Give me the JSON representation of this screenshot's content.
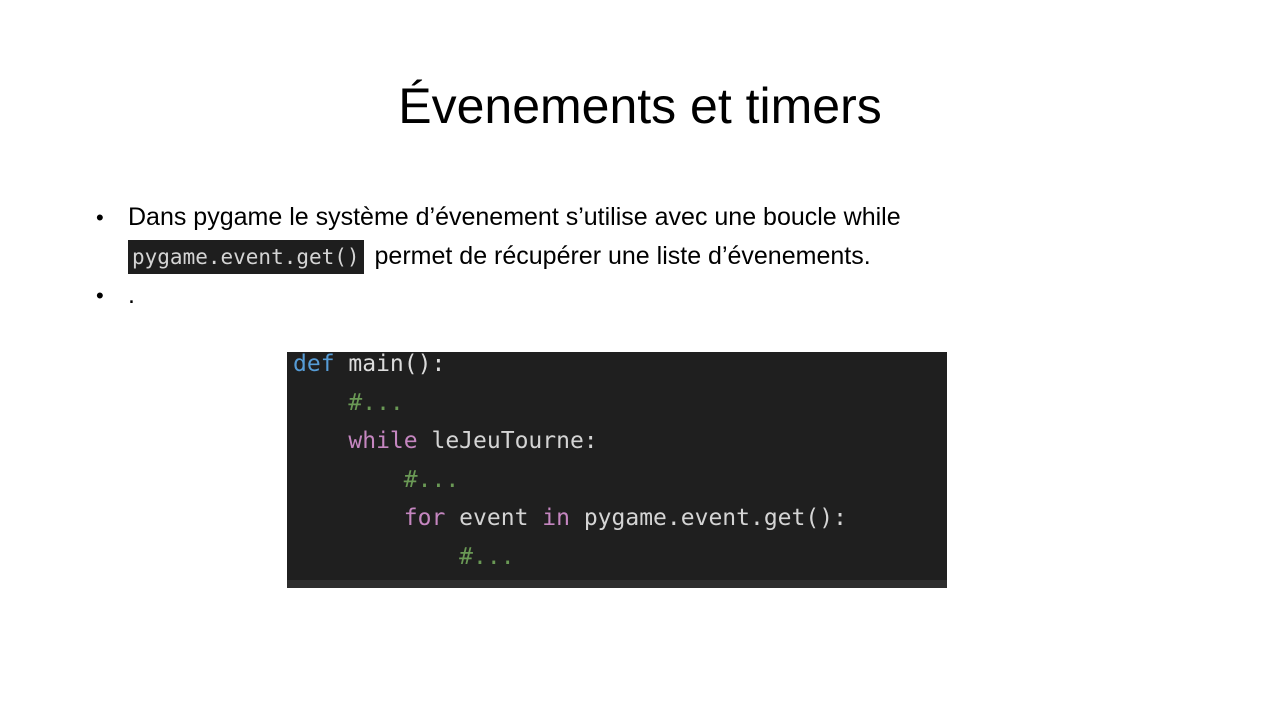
{
  "slide": {
    "title": "Évenements et timers",
    "bullets": [
      {
        "line1": "Dans pygame le système d’évenement s’utilise avec une boucle while",
        "inline_code": "pygame.event.get()",
        "line2_rest": "permet de récupérer une liste d’évenements."
      },
      {
        "text": "."
      }
    ],
    "bullet_glyph": "•",
    "code_block": {
      "lines": [
        {
          "indent": "",
          "tokens": [
            {
              "t": "def",
              "c": "kw-def"
            },
            {
              "t": " main():",
              "c": "fn"
            }
          ]
        },
        {
          "indent": "    ",
          "tokens": [
            {
              "t": "#...",
              "c": "comment"
            }
          ]
        },
        {
          "indent": "    ",
          "tokens": [
            {
              "t": "while",
              "c": "kw"
            },
            {
              "t": " leJeuTourne:",
              "c": "plain"
            }
          ]
        },
        {
          "indent": "        ",
          "tokens": [
            {
              "t": "#...",
              "c": "comment"
            }
          ]
        },
        {
          "indent": "        ",
          "tokens": [
            {
              "t": "for",
              "c": "kw"
            },
            {
              "t": " event ",
              "c": "plain"
            },
            {
              "t": "in",
              "c": "kw"
            },
            {
              "t": " pygame.event.get():",
              "c": "plain"
            }
          ]
        },
        {
          "indent": "            ",
          "tokens": [
            {
              "t": "#...",
              "c": "comment"
            }
          ]
        }
      ]
    }
  }
}
